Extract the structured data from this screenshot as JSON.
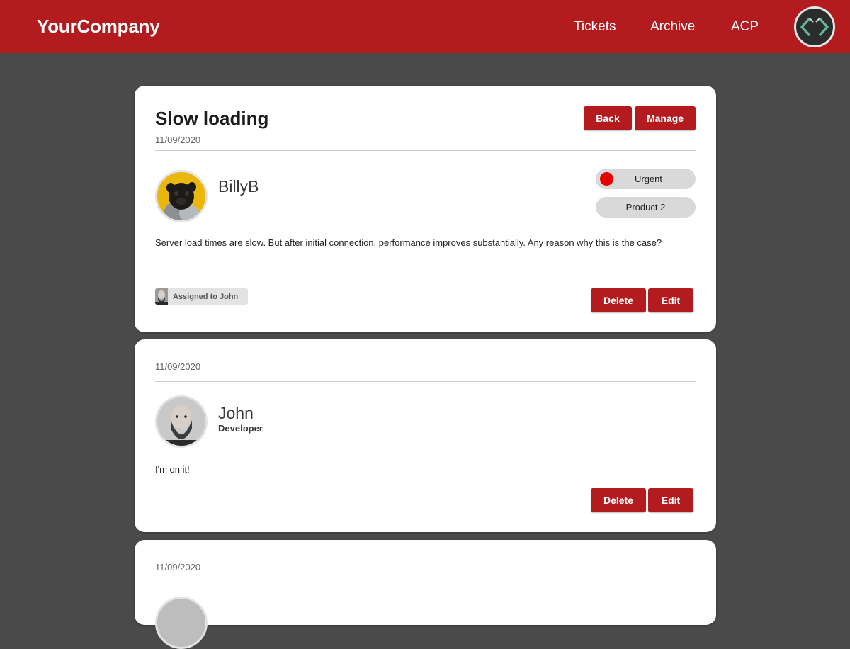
{
  "header": {
    "brand": "YourCompany",
    "nav": [
      "Tickets",
      "Archive",
      "ACP"
    ],
    "logo_icon": "code-brackets-icon",
    "color": "#b31b1f"
  },
  "ticket": {
    "title": "Slow loading",
    "date": "11/09/2020",
    "back_label": "Back",
    "manage_label": "Manage",
    "author": "BillyB",
    "priority": "Urgent",
    "priority_color": "#e60000",
    "product": "Product 2",
    "message": "Server load times are slow. But after initial connection, performance improves substantially. Any reason why this is the case?",
    "assigned_label": "Assigned to John",
    "delete_label": "Delete",
    "edit_label": "Edit"
  },
  "replies": [
    {
      "date": "11/09/2020",
      "author": "John",
      "role": "Developer",
      "message": "I'm on it!",
      "delete_label": "Delete",
      "edit_label": "Edit"
    },
    {
      "date": "11/09/2020"
    }
  ]
}
